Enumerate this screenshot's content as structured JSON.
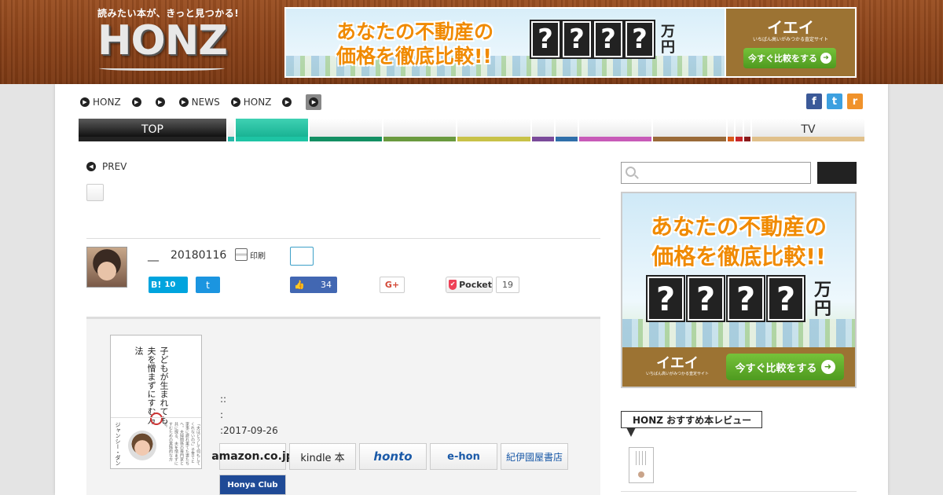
{
  "header": {
    "logo_tagline": "読みたい本が、きっと見つかる!",
    "logo_word": "HONZ"
  },
  "ad_top": {
    "headline_line1": "あなたの不動産の",
    "headline_line2": "価格を徹底比較!!",
    "q1": "?",
    "q2": "?",
    "q3": "?",
    "q4": "?",
    "unit": "万円",
    "brand": "イエイ",
    "brand_sub": "いちばん高いがみつかる査定サイト",
    "cta": "今すぐ比較をする",
    "cta_arrow": "➜"
  },
  "breadcrumb": {
    "items": [
      "HONZ",
      "",
      "",
      "NEWS",
      "HONZ",
      ""
    ]
  },
  "social_top": {
    "facebook": "f",
    "twitter": "t",
    "rss": "r"
  },
  "nav": {
    "top_label": "TOP",
    "tv_label": "TV"
  },
  "article": {
    "prev_label": "PREV",
    "author_name": "__",
    "date": "20180116",
    "print_label": "印刷",
    "hatena_label": "B!",
    "hatena_count": "10",
    "tweet_label": "t",
    "like_count": "34",
    "gplus_label": "G+",
    "pocket_label": "Pocket",
    "pocket_count": "19"
  },
  "book": {
    "cover_title": "子どもが生まれても夫を憎まずにすむ方法",
    "cover_author": "ジャンシー・ダン",
    "cover_blurb": "「夫はどうして何もしてくれないの?」子育てと家事に疲れ果てた妻たちへ。夫婦関係の専門家と共に探る、夫を憎まずにすむための実践的な方法。",
    "meta_line1": "::",
    "meta_line2": ":",
    "meta_line3": ":2017-09-26"
  },
  "stores": {
    "amazon": "amazon.co.jp",
    "kindle": "kindle 本",
    "honto": "honto",
    "ehon": "e-hon",
    "kinokuniya": "紀伊國屋書店",
    "honya": "Honya Club"
  },
  "sidebar": {
    "search_placeholder": "",
    "reco_heading": "HONZ おすすめ本レビュー"
  }
}
